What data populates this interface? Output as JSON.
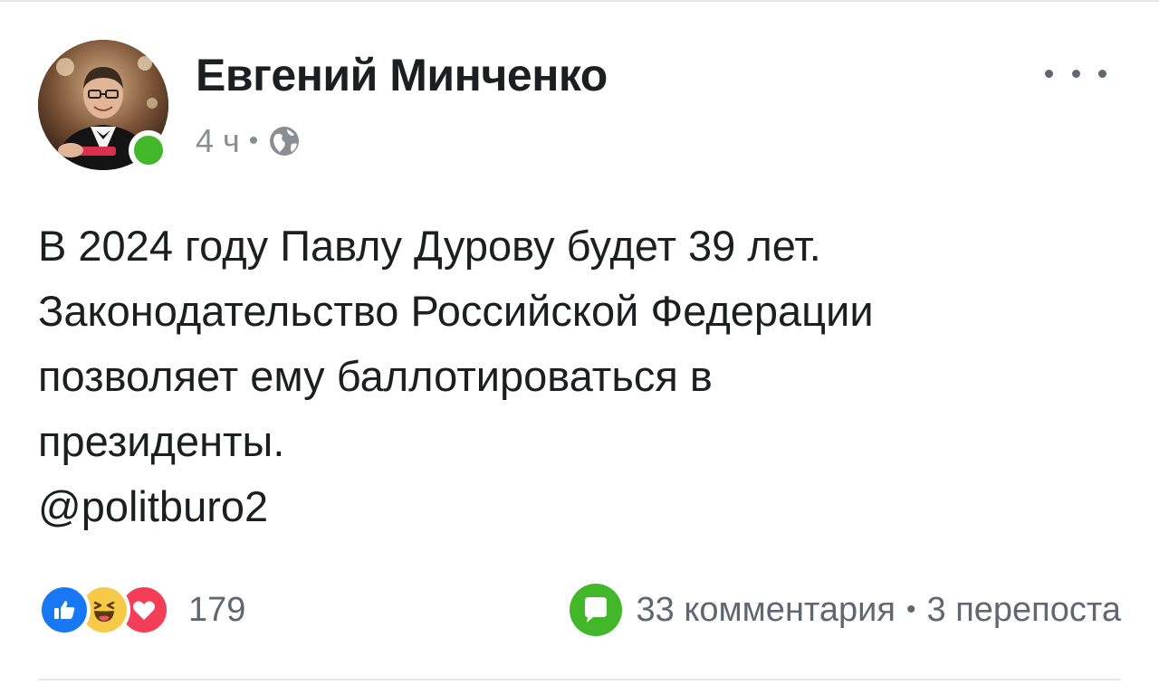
{
  "post": {
    "author": "Евгений Минченко",
    "time": "4 ч",
    "meta_separator": "•",
    "text_lines": [
      "В 2024 году Павлу Дурову будет 39 лет.",
      "Законодательство Российской Федерации",
      "позволяет ему баллотироваться в",
      "президенты.",
      "@politburo2"
    ]
  },
  "footer": {
    "reactions_count": "179",
    "comments": "33 комментария",
    "separator": "•",
    "shares": "3 перепоста"
  },
  "icons": {
    "privacy": "globe-icon",
    "more": "more-options-icon",
    "reactions": [
      "like-icon",
      "haha-icon",
      "love-icon"
    ],
    "comment": "comment-bubble-icon"
  },
  "colors": {
    "text": "#1c1e21",
    "secondary": "#606770",
    "online": "#42b72a",
    "like": "#1877f2",
    "haha": "#f7c948",
    "love": "#f33e58",
    "comment_bubble": "#42b72a"
  }
}
